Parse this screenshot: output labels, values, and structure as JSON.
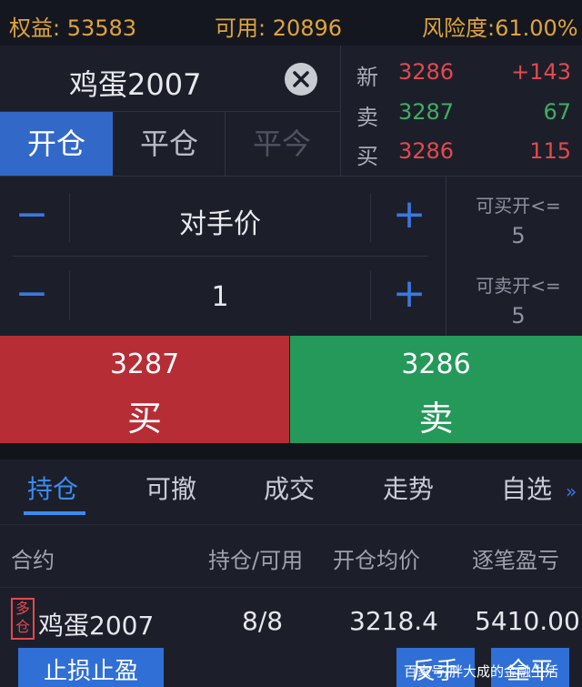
{
  "top_bar": {
    "equity": "权益: 53583",
    "available": "可用: 20896",
    "risk": "风险度:61.00%"
  },
  "instrument": {
    "name": "鸡蛋2007"
  },
  "trade_tabs": [
    "开仓",
    "平仓",
    "平今"
  ],
  "quote": [
    {
      "label": "新",
      "price": "3286",
      "change": "+143"
    },
    {
      "label": "卖",
      "price": "3287",
      "change": "67"
    },
    {
      "label": "买",
      "price": "3286",
      "change": "115"
    }
  ],
  "order": {
    "price_mode": "对手价",
    "quantity": "1",
    "can_buy_label": "可买开<=",
    "can_buy": "5",
    "can_sell_label": "可卖开<=",
    "can_sell": "5",
    "minus": "−",
    "plus": "+"
  },
  "buy": {
    "price": "3287",
    "label": "买"
  },
  "sell": {
    "price": "3286",
    "label": "卖"
  },
  "bottom_tabs": [
    "持仓",
    "可撤",
    "成交",
    "走势",
    "自选"
  ],
  "more_symbol": "»",
  "positions": {
    "headers": [
      "合约",
      "持仓/可用",
      "开仓均价",
      "逐笔盈亏"
    ],
    "rows": [
      {
        "direction": "多仓",
        "contract": "鸡蛋2007",
        "position": "8/8",
        "avg_price": "3218.4",
        "pnl": "5410.00"
      }
    ]
  },
  "actions": {
    "stop": "止损止盈",
    "reverse": "反手",
    "close_all": "全平"
  },
  "watermark": "百家号/胖大成的金融生活",
  "colors": {
    "accent_blue": "#3268c8",
    "buy_red": "#b72d35",
    "sell_green": "#24995a",
    "up_red": "#e2494e",
    "down_green": "#3fae63",
    "header_orange": "#e0a43a"
  }
}
